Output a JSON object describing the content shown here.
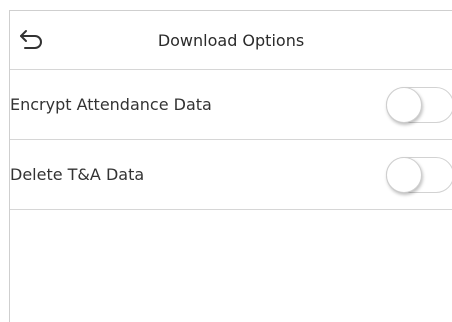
{
  "header": {
    "title": "Download Options",
    "back_icon": "back-arrow-icon"
  },
  "options": [
    {
      "label": "Encrypt Attendance Data",
      "enabled": false
    },
    {
      "label": "Delete T&A Data",
      "enabled": false
    }
  ],
  "colors": {
    "divider": "#d6d6d6",
    "text": "#2b2b2b",
    "toggle_off_border": "#d2d2d2"
  }
}
